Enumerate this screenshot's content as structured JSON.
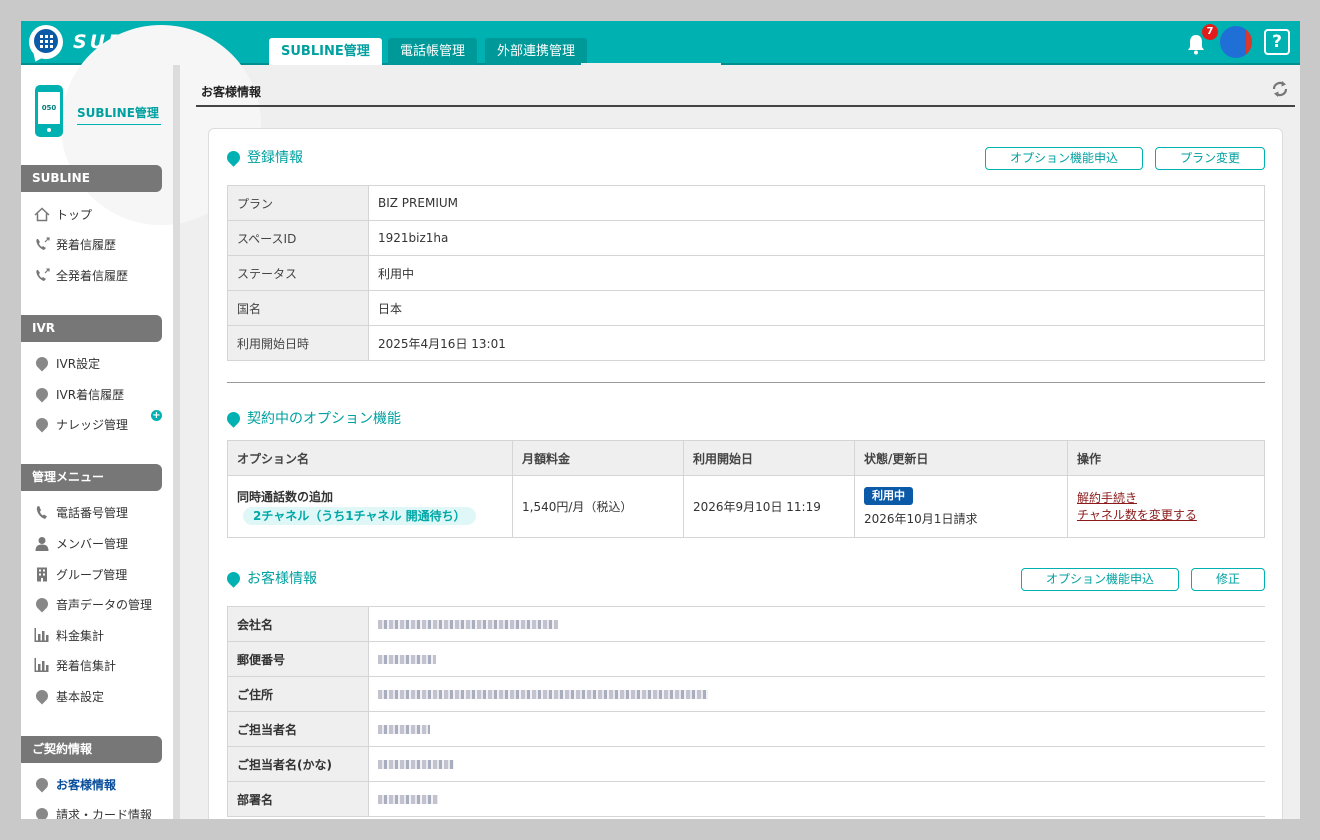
{
  "app": {
    "logo_text": "SUBLINE",
    "notification_count": "7",
    "help_label": "?"
  },
  "tabs": [
    {
      "label": "SUBLINE管理",
      "active": true
    },
    {
      "label": "電話帳管理",
      "active": false
    },
    {
      "label": "外部連携管理",
      "active": false
    }
  ],
  "sidebar": {
    "title": "SUBLINE管理",
    "phone_number_prefix": "050",
    "sections": [
      {
        "title": "SUBLINE",
        "items": [
          {
            "label": "トップ",
            "icon": "home-icon"
          },
          {
            "label": "発着信履歴",
            "icon": "phone-arrow-icon"
          },
          {
            "label": "全発着信履歴",
            "icon": "phone-arrow-icon"
          }
        ]
      },
      {
        "title": "IVR",
        "items": [
          {
            "label": "IVR設定",
            "icon": "pin-icon"
          },
          {
            "label": "IVR着信履歴",
            "icon": "pin-icon",
            "has_expand": true
          },
          {
            "label": "ナレッジ管理",
            "icon": "pin-icon"
          }
        ]
      },
      {
        "title": "管理メニュー",
        "items": [
          {
            "label": "電話番号管理",
            "icon": "phone-icon"
          },
          {
            "label": "メンバー管理",
            "icon": "person-icon"
          },
          {
            "label": "グループ管理",
            "icon": "building-icon"
          },
          {
            "label": "音声データの管理",
            "icon": "pin-icon"
          },
          {
            "label": "料金集計",
            "icon": "bar-chart-icon"
          },
          {
            "label": "発着信集計",
            "icon": "bar-chart-icon"
          },
          {
            "label": "基本設定",
            "icon": "pin-icon"
          }
        ]
      },
      {
        "title": "ご契約情報",
        "items": [
          {
            "label": "お客様情報",
            "icon": "pin-icon",
            "current": true
          },
          {
            "label": "請求・カード情報",
            "icon": "pin-icon"
          }
        ]
      }
    ]
  },
  "page": {
    "title": "お客様情報"
  },
  "registration": {
    "title": "登録情報",
    "buttons": {
      "option_apply": "オプション機能申込",
      "plan_change": "プラン変更"
    },
    "rows": [
      {
        "label": "プラン",
        "value": "BIZ PREMIUM"
      },
      {
        "label": "スペースID",
        "value": "1921biz1ha"
      },
      {
        "label": "ステータス",
        "value": "利用中"
      },
      {
        "label": "国名",
        "value": "日本"
      },
      {
        "label": "利用開始日時",
        "value": "2025年4月16日 13:01"
      }
    ]
  },
  "options": {
    "title": "契約中のオプション機能",
    "headers": [
      "オプション名",
      "月額料金",
      "利用開始日",
      "状態/更新日",
      "操作"
    ],
    "rows": [
      {
        "name": "同時通話数の追加",
        "detail": "2チャネル（うち1チャネル 開通待ち）",
        "fee": "1,540円/月（税込）",
        "start": "2026年9月10日 11:19",
        "status": "利用中",
        "updated": "2026年10月1日請求",
        "actions": [
          "解約手続き",
          "チャネル数を変更する"
        ]
      }
    ]
  },
  "customer": {
    "title": "お客様情報",
    "buttons": {
      "option_apply": "オプション機能申込",
      "edit": "修正"
    },
    "rows": [
      {
        "label": "会社名",
        "redacted": true
      },
      {
        "label": "郵便番号",
        "redacted": true
      },
      {
        "label": "ご住所",
        "redacted": true
      },
      {
        "label": "ご担当者名",
        "redacted": true
      },
      {
        "label": "ご担当者名(かな)",
        "redacted": true
      },
      {
        "label": "部署名",
        "redacted": true
      }
    ]
  },
  "colors": {
    "brand": "#00b1b1",
    "header_bg": "#00b1b1",
    "status_badge": "#0b5aa8",
    "danger_link": "#8b1a1a"
  }
}
